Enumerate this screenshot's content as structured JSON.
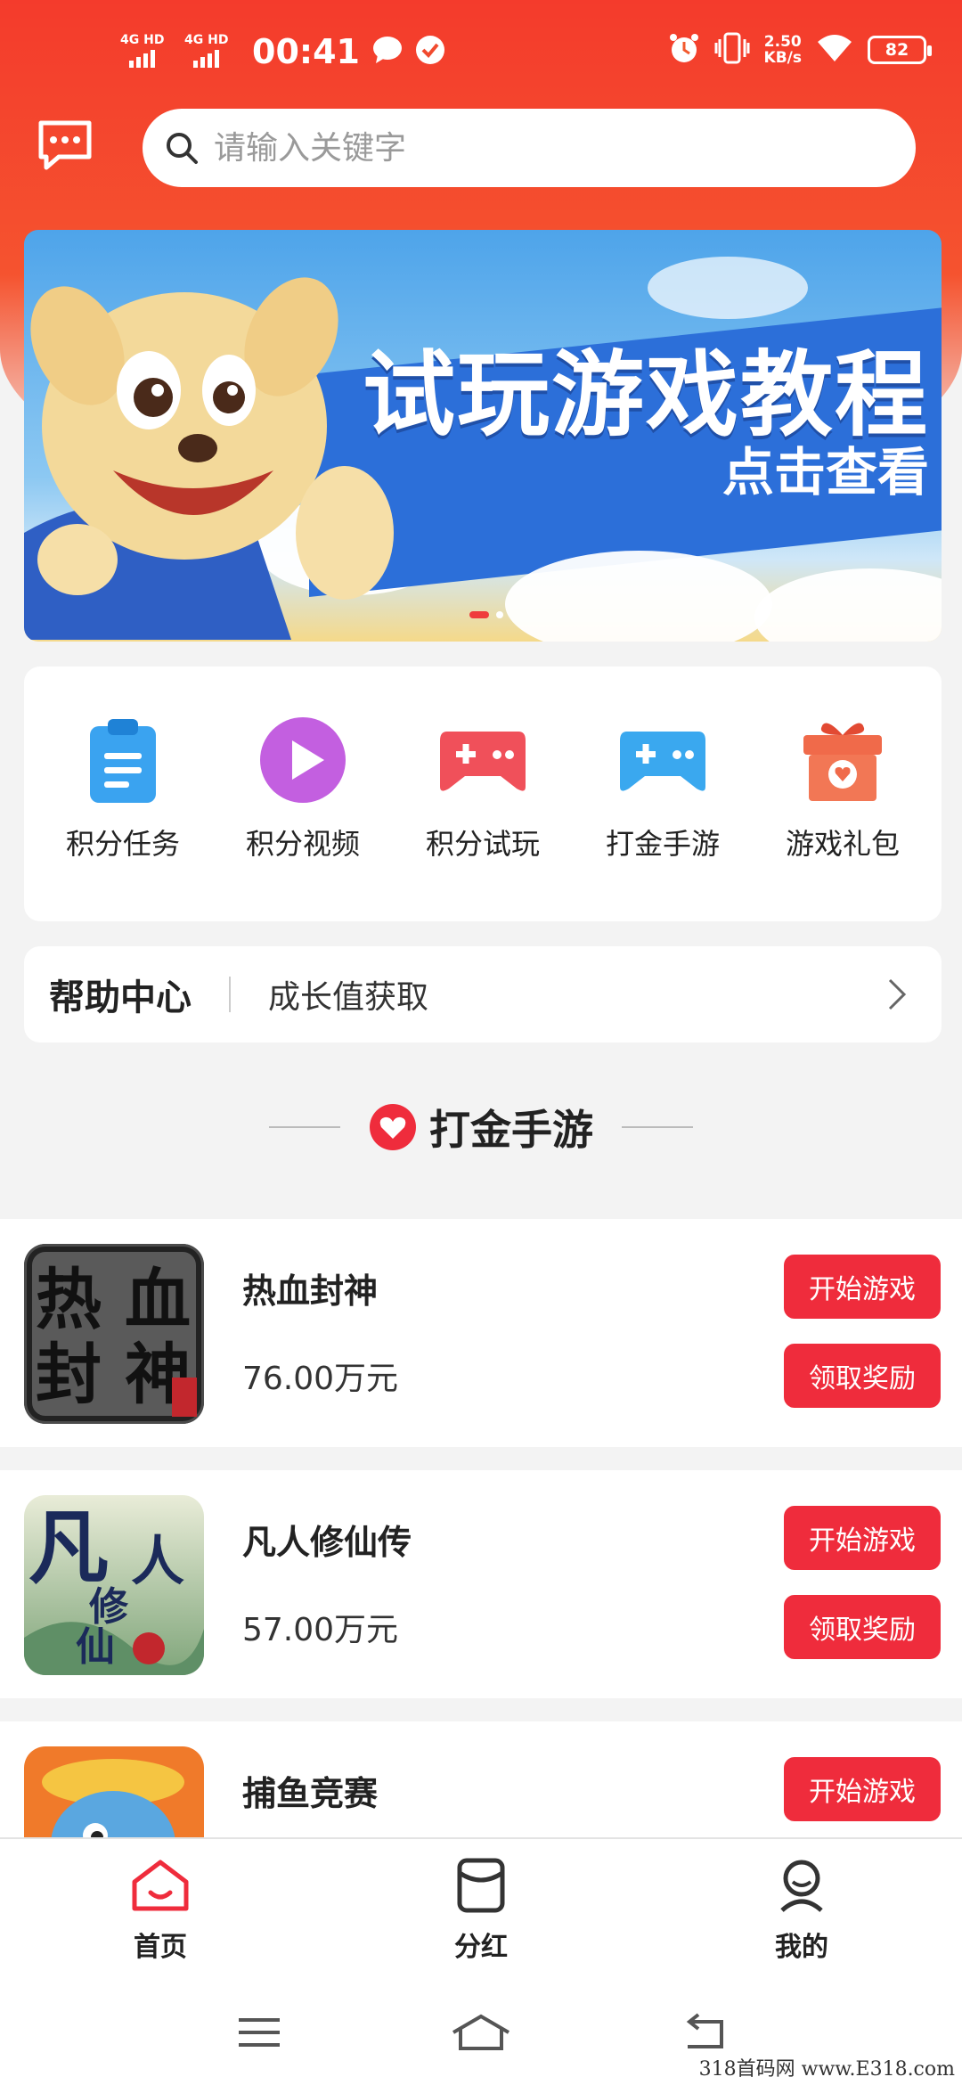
{
  "status_bar": {
    "sig1": "4G HD",
    "sig2": "4G HD",
    "time": "00:41",
    "speed_value": "2.50",
    "speed_unit": "KB/s",
    "battery": "82"
  },
  "search": {
    "placeholder": "请输入关键字"
  },
  "banner": {
    "title": "试玩游戏教程",
    "subtitle": "点击查看",
    "slides": 2,
    "active_slide": 1
  },
  "categories": [
    {
      "label": "积分任务",
      "icon": "clipboard-icon"
    },
    {
      "label": "积分视频",
      "icon": "play-icon"
    },
    {
      "label": "积分试玩",
      "icon": "gamepad-icon"
    },
    {
      "label": "打金手游",
      "icon": "gamepad-icon"
    },
    {
      "label": "游戏礼包",
      "icon": "gift-icon"
    }
  ],
  "help": {
    "title": "帮助中心",
    "text": "成长值获取"
  },
  "section": {
    "title": "打金手游"
  },
  "games": [
    {
      "name": "热血封神",
      "amount": "76.00万元",
      "thumb_text": [
        "热",
        "血",
        "封",
        "神"
      ],
      "start": "开始游戏",
      "reward": "领取奖励"
    },
    {
      "name": "凡人修仙传",
      "amount": "57.00万元",
      "thumb_text": [
        "凡",
        "人",
        "修",
        "仙"
      ],
      "start": "开始游戏",
      "reward": "领取奖励"
    },
    {
      "name": "捕鱼竞赛",
      "amount": "",
      "start": "开始游戏"
    }
  ],
  "tabs": [
    {
      "label": "首页",
      "active": true
    },
    {
      "label": "分红",
      "active": false
    },
    {
      "label": "我的",
      "active": false
    }
  ],
  "colors": {
    "brand_red": "#f43b2c",
    "button_red": "#ef2c3c"
  },
  "watermark": "318首码网 www.E318.com"
}
